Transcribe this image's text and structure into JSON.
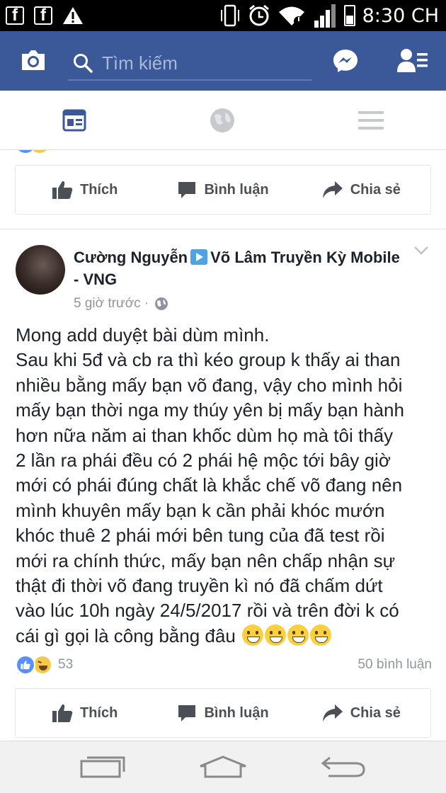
{
  "status_bar": {
    "time": "8:30 CH",
    "icons": [
      "facebook-icon",
      "facebook-icon",
      "warning-icon",
      "vibrate-icon",
      "alarm-icon",
      "wifi-icon",
      "signal-icon",
      "battery-icon"
    ]
  },
  "header": {
    "search_placeholder": "Tìm kiếm",
    "icons": [
      "camera-icon",
      "search-icon",
      "messenger-icon",
      "friend-requests-icon"
    ],
    "brand_color": "#3b5998"
  },
  "tabs": [
    {
      "name": "news-feed",
      "icon": "news-feed-icon",
      "active": true
    },
    {
      "name": "notifications",
      "icon": "globe-icon",
      "active": false
    },
    {
      "name": "menu",
      "icon": "menu-icon",
      "active": false
    }
  ],
  "actions": {
    "like": "Thích",
    "comment": "Bình luận",
    "share": "Chia sẻ"
  },
  "post": {
    "author": "Cường Nguyễn",
    "group": "Võ Lâm Truyền Kỳ Mobile - VNG",
    "time": "5 giờ trước ·",
    "privacy_icon": "globe-icon",
    "body_lines": [
      "Mong add duyệt bài dùm mình.",
      "Sau khi 5đ và cb ra thì kéo group k thấy ai than",
      "nhiều bằng mấy bạn võ đang, vậy cho mình hỏi",
      "mấy bạn thời nga my thúy yên bị mấy bạn hành",
      "hơn nữa năm ai than khốc dùm họ mà tôi thấy",
      "2 lần ra phái đều có 2 phái hệ mộc tới bây giờ",
      "mới có phái đúng chất là khắc chế võ đang nên",
      "mình khuyên mấy bạn k cần phải khóc mướn",
      "khóc thuê 2 phái mới bên tung của đã test rồi",
      "mới ra chính thức, mấy bạn nên chấp nhận sự",
      "thật đi thời võ đang truyền kì nó đã chấm dứt",
      "vào lúc 10h ngày 24/5/2017 rồi và trên đời k có",
      "cái gì gọi là công bằng đâu"
    ],
    "body_emoji": [
      "grinning-emoji",
      "grinning-emoji",
      "grinning-emoji",
      "grinning-emoji"
    ],
    "reaction_count": "53",
    "reaction_icons": [
      "like-reaction-icon",
      "haha-reaction-icon"
    ],
    "comments": "50 bình luận"
  },
  "nav_bar": {
    "icons": [
      "recent-apps-icon",
      "home-icon",
      "back-icon"
    ]
  }
}
